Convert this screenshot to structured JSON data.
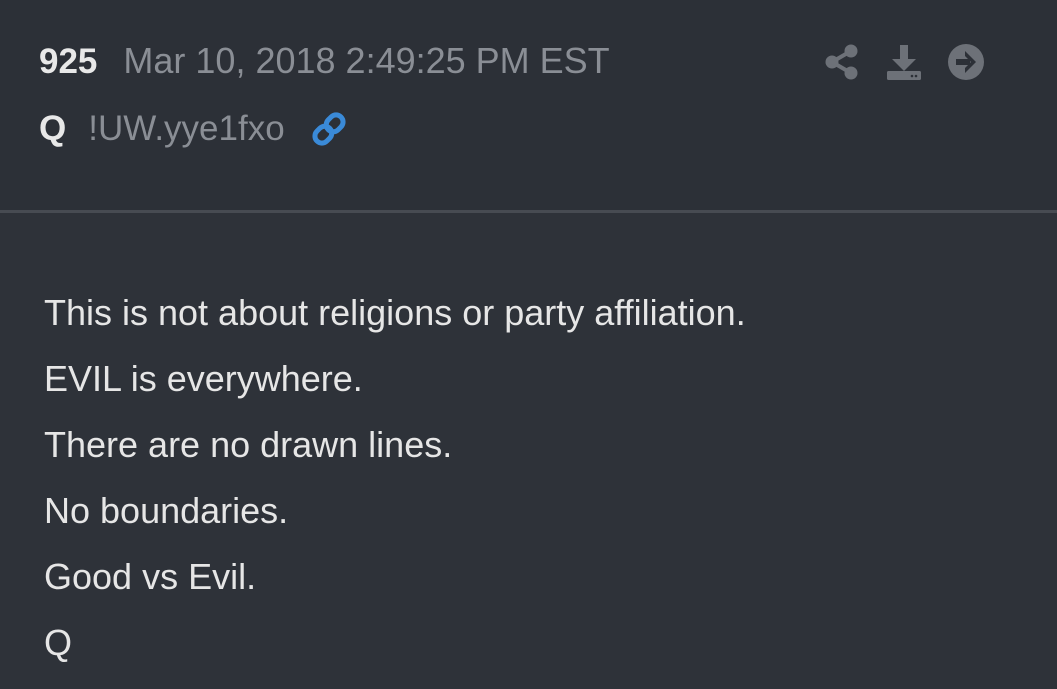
{
  "post": {
    "number": "925",
    "date": "Mar 10, 2018 2:49:25 PM EST",
    "author": "Q",
    "tripcode": "!UW.yye1fxo",
    "icons": {
      "link": "link-icon",
      "share": "share-icon",
      "download": "download-icon",
      "open": "arrow-circle-right-icon"
    },
    "colors": {
      "link_accent": "#3a8ad8",
      "icon_gray": "#6d7178",
      "background": "#2e3239"
    },
    "lines": [
      "This is not about religions or party affiliation.",
      "EVIL is everywhere.",
      "There are no drawn lines.",
      "No boundaries.",
      "Good vs Evil.",
      "Q"
    ]
  }
}
